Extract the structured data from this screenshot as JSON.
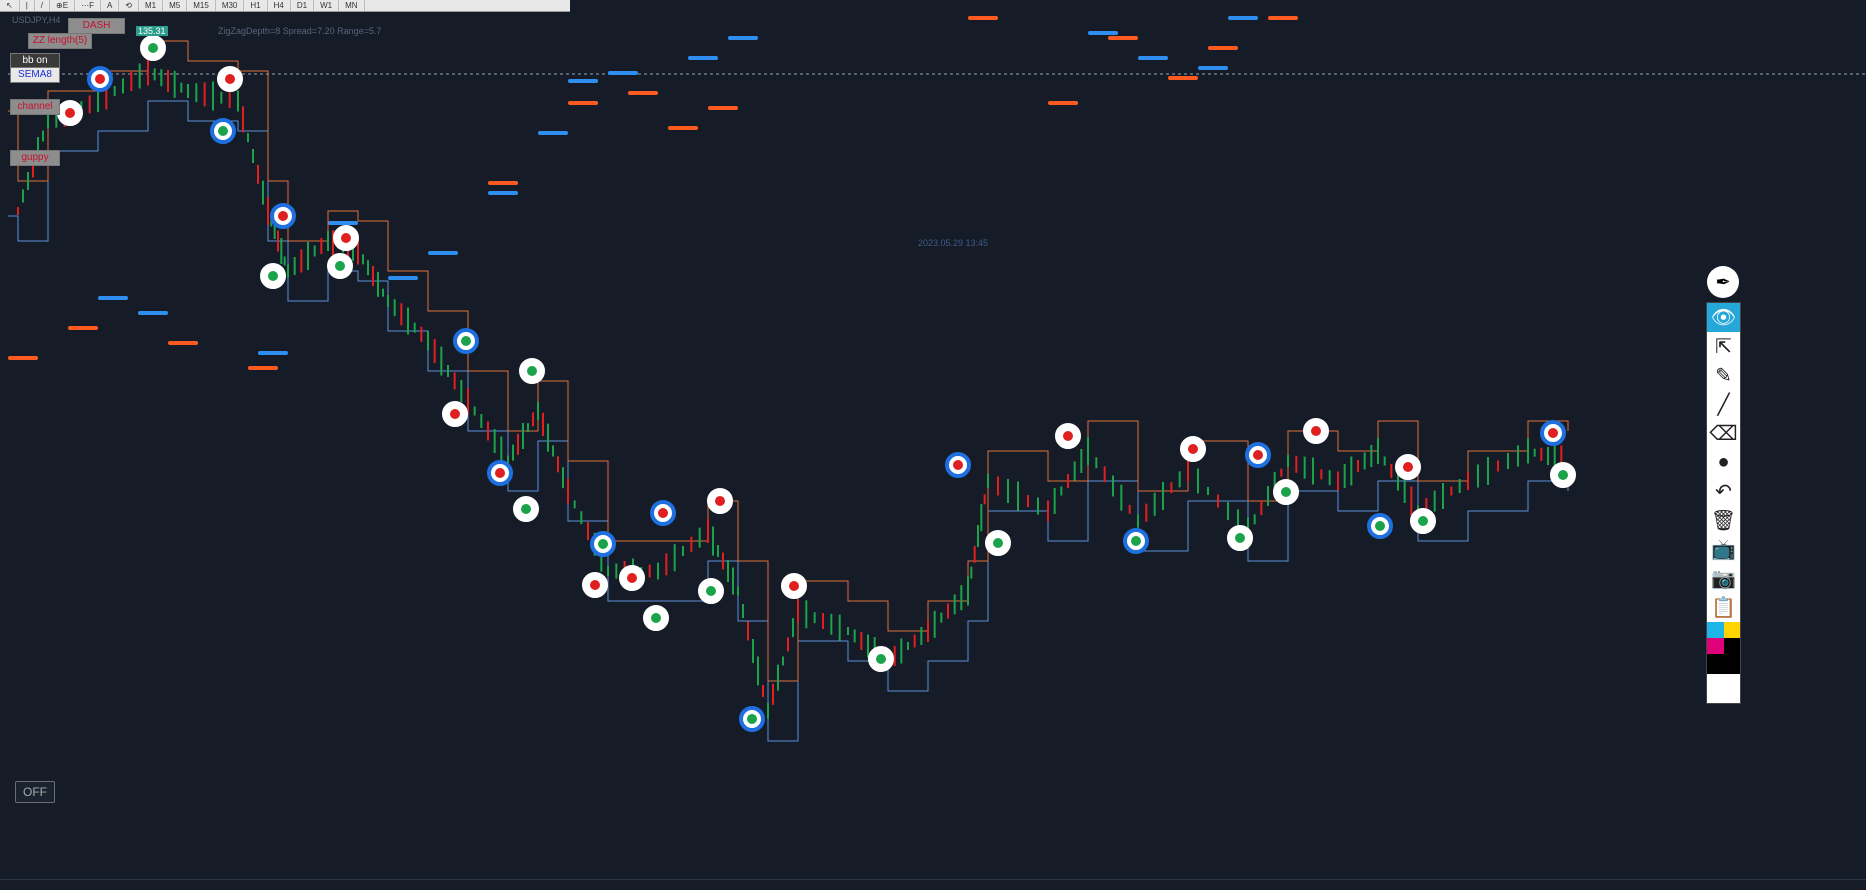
{
  "toolbar": {
    "timeframes": [
      "M1",
      "M5",
      "M15",
      "M30",
      "H1",
      "H4",
      "D1",
      "W1",
      "MN"
    ],
    "tool_glyphs": [
      "↖",
      "|",
      "/",
      "⊕E",
      "⋯F",
      "A",
      "⟲"
    ]
  },
  "chart_info": {
    "symbol": "USDJPY,H4",
    "header_text": "ZigZagDepth=8  Spread=7.20  Range=5.7",
    "price_badge": "135.31",
    "timestamp": "2023.05.29 13:45"
  },
  "left_buttons": [
    {
      "label": "DASH",
      "style": "grey"
    },
    {
      "label": "ZZ length(5)",
      "style": "grey"
    },
    {
      "label": "bb on",
      "style": "dark"
    },
    {
      "label": "SEMA8",
      "style": "blue"
    },
    {
      "label": "channel",
      "style": "grey"
    },
    {
      "label": "guppy",
      "style": "grey"
    }
  ],
  "off_button": {
    "label": "OFF"
  },
  "drawing_tools": [
    {
      "name": "eye-icon",
      "glyph": "👁",
      "active": true
    },
    {
      "name": "cursor-icon",
      "glyph": "⇱",
      "active": false
    },
    {
      "name": "marker-icon",
      "glyph": "✎",
      "active": false
    },
    {
      "name": "line-icon",
      "glyph": "╱",
      "active": false
    },
    {
      "name": "eraser-icon",
      "glyph": "⌫",
      "active": false
    },
    {
      "name": "dot-icon",
      "glyph": "●",
      "active": false
    },
    {
      "name": "undo-icon",
      "glyph": "↶",
      "active": false
    },
    {
      "name": "trash-icon",
      "glyph": "🗑",
      "active": false
    },
    {
      "name": "tv-icon",
      "glyph": "📺",
      "active": false
    },
    {
      "name": "camera-icon",
      "glyph": "📷",
      "active": false
    },
    {
      "name": "clipboard-icon",
      "glyph": "📋",
      "active": false
    }
  ],
  "palette_colors": [
    "#1db4e8",
    "#ffd400",
    "#e0007a",
    "#000000"
  ],
  "colors": {
    "background": "#151c28",
    "bull": "#1aa34a",
    "bear": "#e02020",
    "level_blue": "#2f8ff0",
    "level_orange": "#ff5a1f",
    "target_ring": "#1e6fe0"
  }
}
